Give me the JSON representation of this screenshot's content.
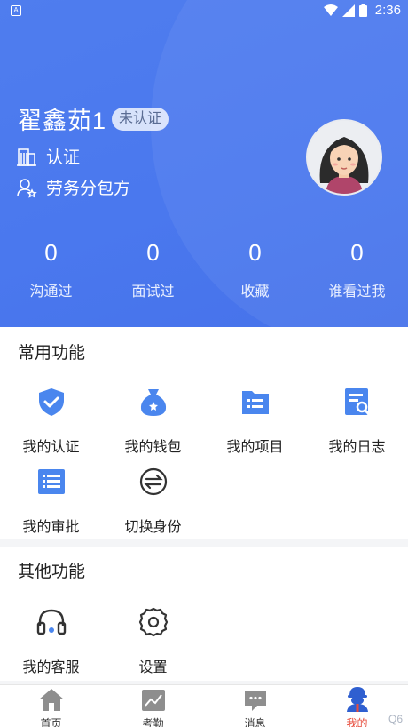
{
  "status_bar": {
    "time": "2:36",
    "app_badge": "A"
  },
  "profile": {
    "name": "翟鑫茹1",
    "verify_badge": "未认证",
    "certify_label": "认证",
    "role_label": "劳务分包方",
    "avatar_icon": "avatar-girl"
  },
  "stats": [
    {
      "value": "0",
      "label": "沟通过"
    },
    {
      "value": "0",
      "label": "面试过"
    },
    {
      "value": "0",
      "label": "收藏"
    },
    {
      "value": "0",
      "label": "谁看过我"
    }
  ],
  "common_functions": {
    "title": "常用功能",
    "items": [
      {
        "label": "我的认证",
        "icon": "shield-check-icon"
      },
      {
        "label": "我的钱包",
        "icon": "money-bag-icon"
      },
      {
        "label": "我的项目",
        "icon": "folder-list-icon"
      },
      {
        "label": "我的日志",
        "icon": "document-search-icon"
      },
      {
        "label": "我的审批",
        "icon": "approval-list-icon"
      },
      {
        "label": "切换身份",
        "icon": "switch-icon"
      }
    ]
  },
  "other_functions": {
    "title": "其他功能",
    "items": [
      {
        "label": "我的客服",
        "icon": "headset-icon"
      },
      {
        "label": "设置",
        "icon": "gear-icon"
      }
    ]
  },
  "tabbar": {
    "items": [
      {
        "label": "首页",
        "icon": "home-icon"
      },
      {
        "label": "考勤",
        "icon": "chart-icon"
      },
      {
        "label": "消息",
        "icon": "message-icon"
      },
      {
        "label": "我的",
        "icon": "user-icon",
        "active": true
      }
    ]
  },
  "watermark": "Q6",
  "colors": {
    "primary": "#4a78ee",
    "accent_red": "#e74c3c",
    "icon_blue": "#4a86ee"
  }
}
